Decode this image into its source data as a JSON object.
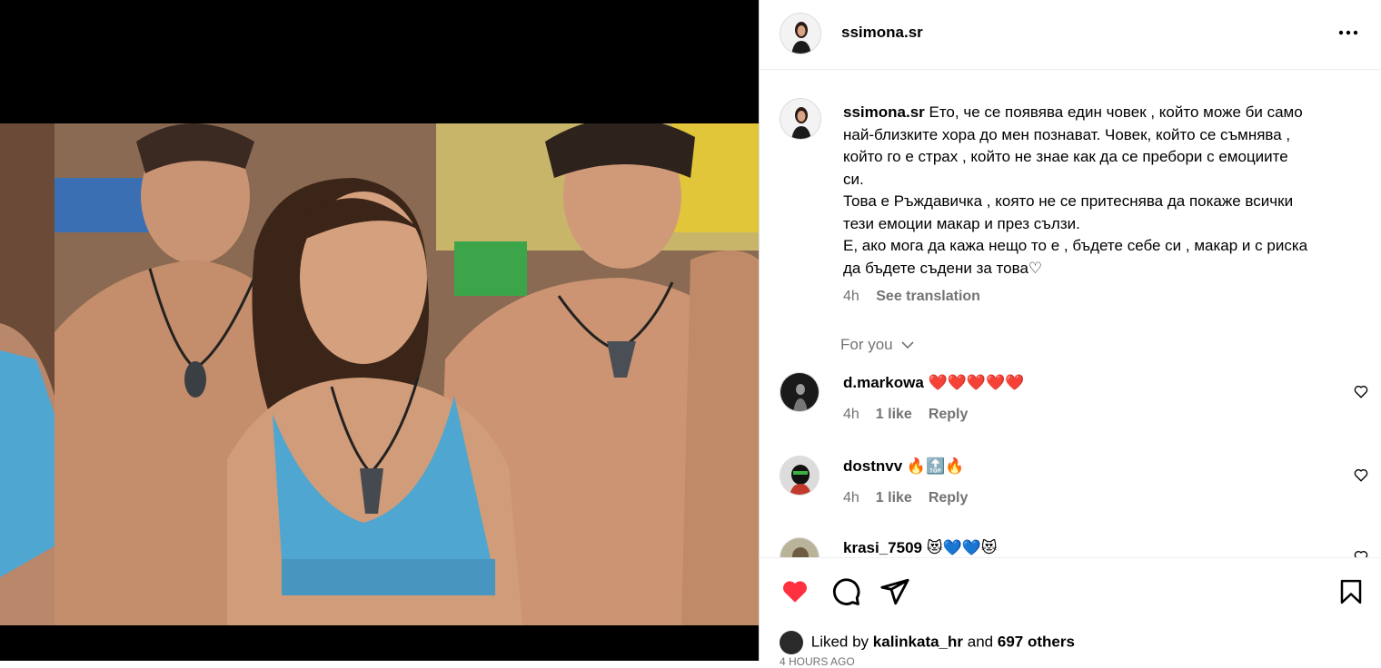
{
  "post": {
    "username": "ssimona.sr",
    "caption_lines": [
      "Ето, че се появява един човек , който може би само",
      "най-близките хора до мен познават. Човек, който се съмнява ,",
      "който го е страх , който не знае как да се пребори с емоциите",
      "си.",
      "Това е Ръждавичка , която не се притеснява да покаже всички",
      "тези емоции макар и през сълзи.",
      "Е, ако мога да кажа нещо то е , бъдете себе си , макар и с риска",
      "да бъдете съдени за това♡"
    ],
    "time": "4h",
    "see_translation": "See translation",
    "for_you": "For you"
  },
  "comments": [
    {
      "username": "d.markowa",
      "text": "❤️❤️❤️❤️❤️",
      "time": "4h",
      "likes": "1 like",
      "reply": "Reply"
    },
    {
      "username": "dostnvv",
      "text": "🔥🔝🔥",
      "time": "4h",
      "likes": "1 like",
      "reply": "Reply"
    },
    {
      "username": "krasi_7509",
      "text": "😻💙💙😻",
      "time": "",
      "likes": "",
      "reply": ""
    }
  ],
  "footer": {
    "liked_by_prefix": "Liked by",
    "liked_by_user": "kalinkata_hr",
    "and": "and",
    "others": "697 others",
    "time_ago": "4 hours ago"
  },
  "icons": [
    "more-icon",
    "like-heart-filled-icon",
    "comment-icon",
    "share-icon",
    "save-icon",
    "comment-like-icon",
    "chevron-down-icon"
  ],
  "colors": {
    "like_red": "#ff3040",
    "meta_gray": "#737373",
    "swimsuit_blue": "#4fa6d0"
  }
}
